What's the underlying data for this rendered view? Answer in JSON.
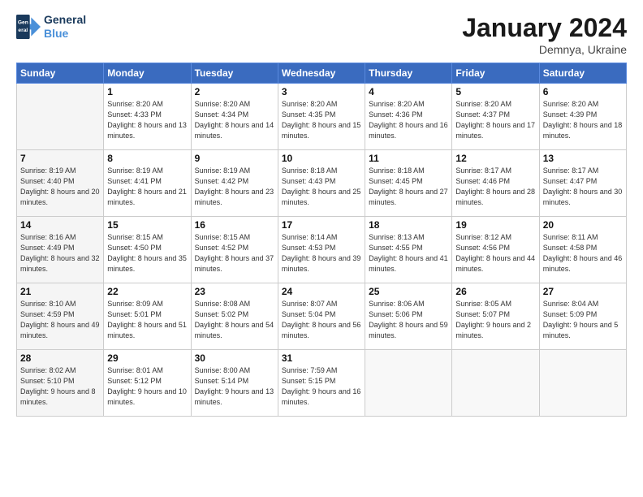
{
  "header": {
    "logo_line1": "General",
    "logo_line2": "Blue",
    "title": "January 2024",
    "subtitle": "Demnya, Ukraine"
  },
  "weekdays": [
    "Sunday",
    "Monday",
    "Tuesday",
    "Wednesday",
    "Thursday",
    "Friday",
    "Saturday"
  ],
  "weeks": [
    [
      {
        "day": "",
        "sunrise": "",
        "sunset": "",
        "daylight": ""
      },
      {
        "day": "1",
        "sunrise": "Sunrise: 8:20 AM",
        "sunset": "Sunset: 4:33 PM",
        "daylight": "Daylight: 8 hours and 13 minutes."
      },
      {
        "day": "2",
        "sunrise": "Sunrise: 8:20 AM",
        "sunset": "Sunset: 4:34 PM",
        "daylight": "Daylight: 8 hours and 14 minutes."
      },
      {
        "day": "3",
        "sunrise": "Sunrise: 8:20 AM",
        "sunset": "Sunset: 4:35 PM",
        "daylight": "Daylight: 8 hours and 15 minutes."
      },
      {
        "day": "4",
        "sunrise": "Sunrise: 8:20 AM",
        "sunset": "Sunset: 4:36 PM",
        "daylight": "Daylight: 8 hours and 16 minutes."
      },
      {
        "day": "5",
        "sunrise": "Sunrise: 8:20 AM",
        "sunset": "Sunset: 4:37 PM",
        "daylight": "Daylight: 8 hours and 17 minutes."
      },
      {
        "day": "6",
        "sunrise": "Sunrise: 8:20 AM",
        "sunset": "Sunset: 4:39 PM",
        "daylight": "Daylight: 8 hours and 18 minutes."
      }
    ],
    [
      {
        "day": "7",
        "sunrise": "Sunrise: 8:19 AM",
        "sunset": "Sunset: 4:40 PM",
        "daylight": "Daylight: 8 hours and 20 minutes."
      },
      {
        "day": "8",
        "sunrise": "Sunrise: 8:19 AM",
        "sunset": "Sunset: 4:41 PM",
        "daylight": "Daylight: 8 hours and 21 minutes."
      },
      {
        "day": "9",
        "sunrise": "Sunrise: 8:19 AM",
        "sunset": "Sunset: 4:42 PM",
        "daylight": "Daylight: 8 hours and 23 minutes."
      },
      {
        "day": "10",
        "sunrise": "Sunrise: 8:18 AM",
        "sunset": "Sunset: 4:43 PM",
        "daylight": "Daylight: 8 hours and 25 minutes."
      },
      {
        "day": "11",
        "sunrise": "Sunrise: 8:18 AM",
        "sunset": "Sunset: 4:45 PM",
        "daylight": "Daylight: 8 hours and 27 minutes."
      },
      {
        "day": "12",
        "sunrise": "Sunrise: 8:17 AM",
        "sunset": "Sunset: 4:46 PM",
        "daylight": "Daylight: 8 hours and 28 minutes."
      },
      {
        "day": "13",
        "sunrise": "Sunrise: 8:17 AM",
        "sunset": "Sunset: 4:47 PM",
        "daylight": "Daylight: 8 hours and 30 minutes."
      }
    ],
    [
      {
        "day": "14",
        "sunrise": "Sunrise: 8:16 AM",
        "sunset": "Sunset: 4:49 PM",
        "daylight": "Daylight: 8 hours and 32 minutes."
      },
      {
        "day": "15",
        "sunrise": "Sunrise: 8:15 AM",
        "sunset": "Sunset: 4:50 PM",
        "daylight": "Daylight: 8 hours and 35 minutes."
      },
      {
        "day": "16",
        "sunrise": "Sunrise: 8:15 AM",
        "sunset": "Sunset: 4:52 PM",
        "daylight": "Daylight: 8 hours and 37 minutes."
      },
      {
        "day": "17",
        "sunrise": "Sunrise: 8:14 AM",
        "sunset": "Sunset: 4:53 PM",
        "daylight": "Daylight: 8 hours and 39 minutes."
      },
      {
        "day": "18",
        "sunrise": "Sunrise: 8:13 AM",
        "sunset": "Sunset: 4:55 PM",
        "daylight": "Daylight: 8 hours and 41 minutes."
      },
      {
        "day": "19",
        "sunrise": "Sunrise: 8:12 AM",
        "sunset": "Sunset: 4:56 PM",
        "daylight": "Daylight: 8 hours and 44 minutes."
      },
      {
        "day": "20",
        "sunrise": "Sunrise: 8:11 AM",
        "sunset": "Sunset: 4:58 PM",
        "daylight": "Daylight: 8 hours and 46 minutes."
      }
    ],
    [
      {
        "day": "21",
        "sunrise": "Sunrise: 8:10 AM",
        "sunset": "Sunset: 4:59 PM",
        "daylight": "Daylight: 8 hours and 49 minutes."
      },
      {
        "day": "22",
        "sunrise": "Sunrise: 8:09 AM",
        "sunset": "Sunset: 5:01 PM",
        "daylight": "Daylight: 8 hours and 51 minutes."
      },
      {
        "day": "23",
        "sunrise": "Sunrise: 8:08 AM",
        "sunset": "Sunset: 5:02 PM",
        "daylight": "Daylight: 8 hours and 54 minutes."
      },
      {
        "day": "24",
        "sunrise": "Sunrise: 8:07 AM",
        "sunset": "Sunset: 5:04 PM",
        "daylight": "Daylight: 8 hours and 56 minutes."
      },
      {
        "day": "25",
        "sunrise": "Sunrise: 8:06 AM",
        "sunset": "Sunset: 5:06 PM",
        "daylight": "Daylight: 8 hours and 59 minutes."
      },
      {
        "day": "26",
        "sunrise": "Sunrise: 8:05 AM",
        "sunset": "Sunset: 5:07 PM",
        "daylight": "Daylight: 9 hours and 2 minutes."
      },
      {
        "day": "27",
        "sunrise": "Sunrise: 8:04 AM",
        "sunset": "Sunset: 5:09 PM",
        "daylight": "Daylight: 9 hours and 5 minutes."
      }
    ],
    [
      {
        "day": "28",
        "sunrise": "Sunrise: 8:02 AM",
        "sunset": "Sunset: 5:10 PM",
        "daylight": "Daylight: 9 hours and 8 minutes."
      },
      {
        "day": "29",
        "sunrise": "Sunrise: 8:01 AM",
        "sunset": "Sunset: 5:12 PM",
        "daylight": "Daylight: 9 hours and 10 minutes."
      },
      {
        "day": "30",
        "sunrise": "Sunrise: 8:00 AM",
        "sunset": "Sunset: 5:14 PM",
        "daylight": "Daylight: 9 hours and 13 minutes."
      },
      {
        "day": "31",
        "sunrise": "Sunrise: 7:59 AM",
        "sunset": "Sunset: 5:15 PM",
        "daylight": "Daylight: 9 hours and 16 minutes."
      },
      {
        "day": "",
        "sunrise": "",
        "sunset": "",
        "daylight": ""
      },
      {
        "day": "",
        "sunrise": "",
        "sunset": "",
        "daylight": ""
      },
      {
        "day": "",
        "sunrise": "",
        "sunset": "",
        "daylight": ""
      }
    ]
  ]
}
